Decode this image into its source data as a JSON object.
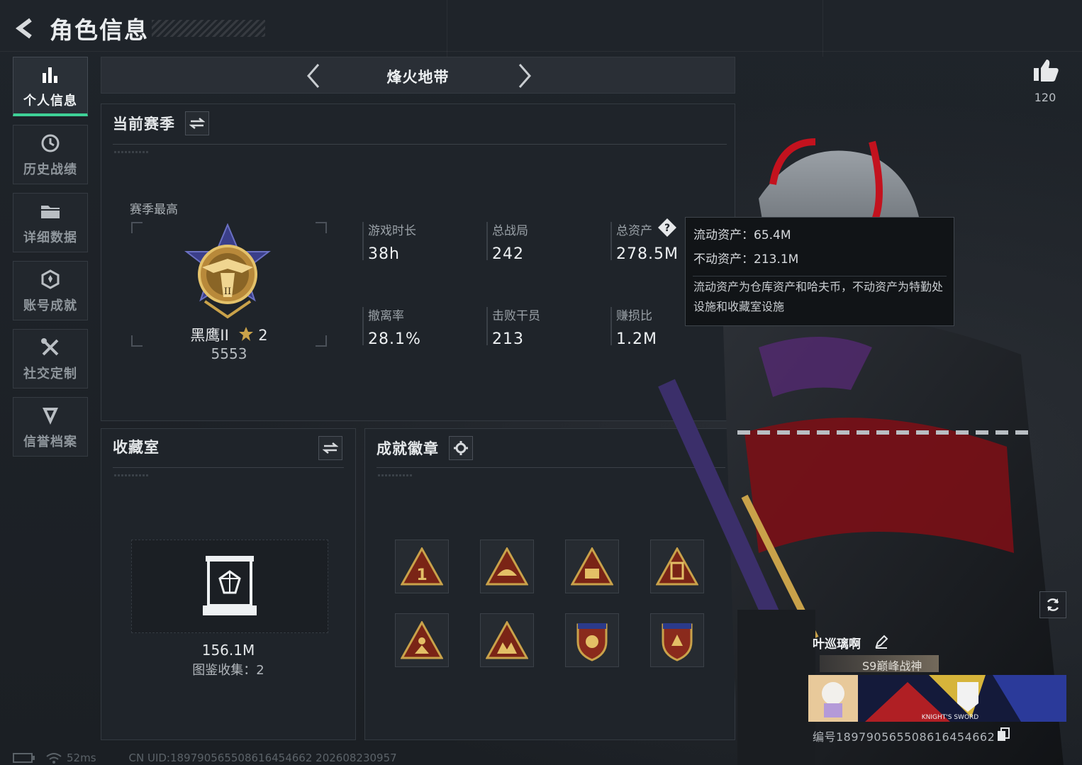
{
  "header": {
    "title": "角色信息"
  },
  "nav": {
    "items": [
      {
        "label": "个人信息",
        "icon": "bar-chart-icon",
        "active": true
      },
      {
        "label": "历史战绩",
        "icon": "history-icon",
        "active": false
      },
      {
        "label": "详细数据",
        "icon": "folder-icon",
        "active": false
      },
      {
        "label": "账号成就",
        "icon": "achievement-icon",
        "active": false
      },
      {
        "label": "社交定制",
        "icon": "tools-icon",
        "active": false
      },
      {
        "label": "信誉档案",
        "icon": "shield-icon",
        "active": false
      }
    ]
  },
  "mode": {
    "title": "烽火地带"
  },
  "season": {
    "title": "当前赛季",
    "best_label": "赛季最高",
    "rank_name": "黑鹰II",
    "rank_stars": "2",
    "rank_score": "5553",
    "stats": [
      {
        "label": "游戏时长",
        "value": "38h"
      },
      {
        "label": "总战局",
        "value": "242"
      },
      {
        "label": "总资产",
        "value": "278.5M"
      },
      {
        "label": "撤离率",
        "value": "28.1%"
      },
      {
        "label": "击败干员",
        "value": "213"
      },
      {
        "label": "赚损比",
        "value": "1.2M"
      }
    ]
  },
  "tooltip": {
    "liquid": "流动资产：65.4M",
    "fixed": "不动资产：213.1M",
    "desc": "流动资产为仓库资产和哈夫币，不动资产为特勤处设施和收藏室设施"
  },
  "collection": {
    "title": "收藏室",
    "value": "156.1M",
    "count": "图鉴收集：2"
  },
  "badges": {
    "title": "成就徽章"
  },
  "character": {
    "likes": "120",
    "name": "叶巡璃啊",
    "title": "S9巅峰战神",
    "banner_text": "KNIGHT'S SWORD",
    "uid": "编号1897905655086164546​62"
  },
  "status": {
    "ping": "52ms",
    "uid": "CN UID:1897905655086164546​62 202608230957"
  },
  "colors": {
    "accent": "#3ed197",
    "gold": "#c9a24a",
    "badge_red": "#8a2a1c"
  }
}
